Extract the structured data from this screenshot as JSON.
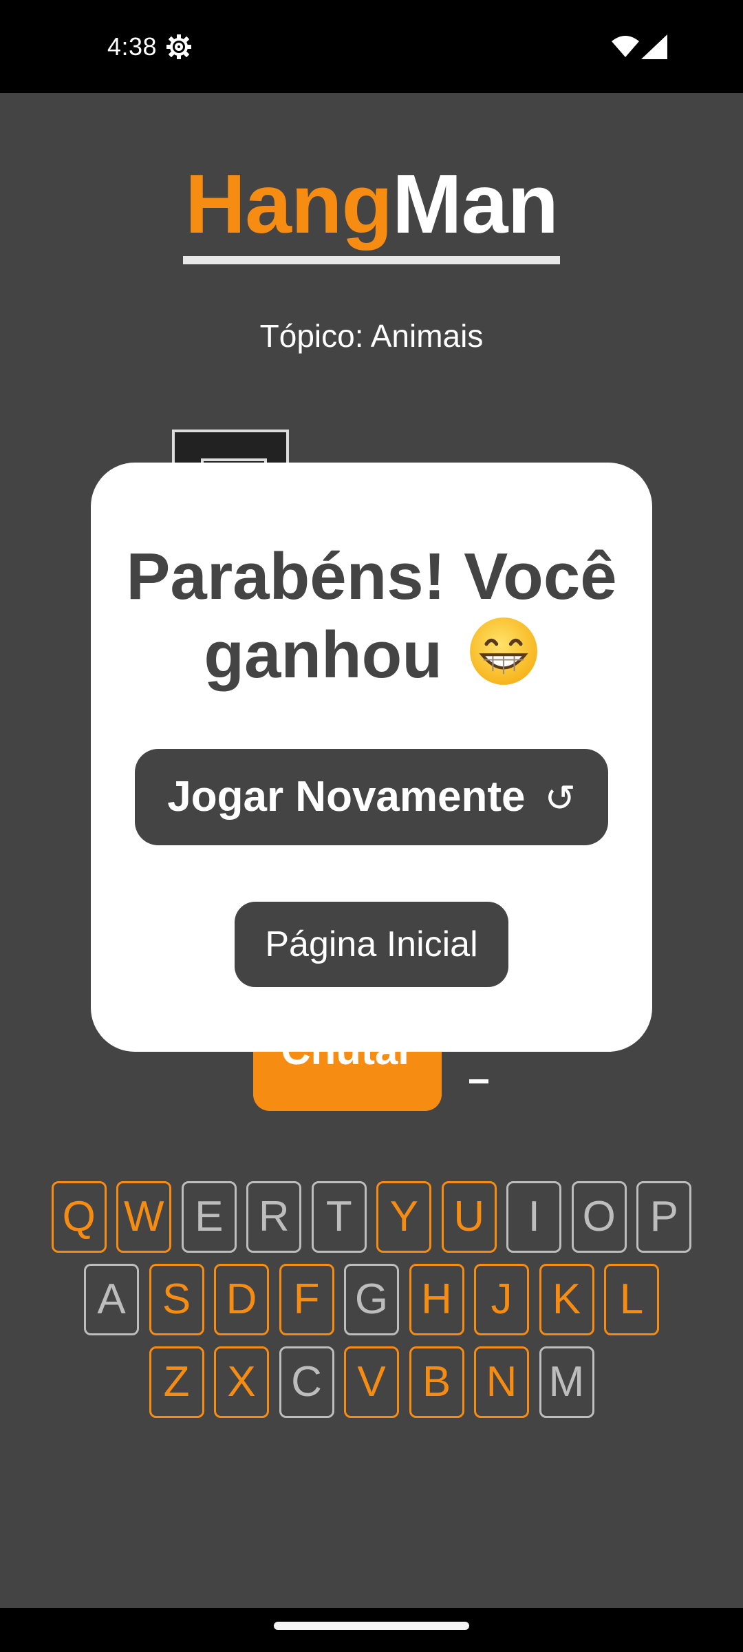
{
  "status_bar": {
    "time": "4:38",
    "icons": [
      "settings-gear-icon",
      "wifi-icon",
      "cellular-signal-icon"
    ]
  },
  "app": {
    "title_part1": "Hang",
    "title_part2": "Man",
    "topic": "Tópico: Animais",
    "guess_button_label": "Chutar",
    "accent_color": "#f78c12",
    "background_color": "#444444"
  },
  "keyboard": {
    "rows": [
      [
        {
          "letter": "Q",
          "used": true
        },
        {
          "letter": "W",
          "used": true
        },
        {
          "letter": "E",
          "used": false
        },
        {
          "letter": "R",
          "used": false
        },
        {
          "letter": "T",
          "used": false
        },
        {
          "letter": "Y",
          "used": true
        },
        {
          "letter": "U",
          "used": true
        },
        {
          "letter": "I",
          "used": false
        },
        {
          "letter": "O",
          "used": false
        },
        {
          "letter": "P",
          "used": false
        }
      ],
      [
        {
          "letter": "A",
          "used": false
        },
        {
          "letter": "S",
          "used": true
        },
        {
          "letter": "D",
          "used": true
        },
        {
          "letter": "F",
          "used": true
        },
        {
          "letter": "G",
          "used": false
        },
        {
          "letter": "H",
          "used": true
        },
        {
          "letter": "J",
          "used": true
        },
        {
          "letter": "K",
          "used": true
        },
        {
          "letter": "L",
          "used": true
        }
      ],
      [
        {
          "letter": "Z",
          "used": true
        },
        {
          "letter": "X",
          "used": true
        },
        {
          "letter": "C",
          "used": false
        },
        {
          "letter": "V",
          "used": true
        },
        {
          "letter": "B",
          "used": true
        },
        {
          "letter": "N",
          "used": true
        },
        {
          "letter": "M",
          "used": false
        }
      ]
    ]
  },
  "modal": {
    "message": "Parabéns! Você ganhou",
    "emoji": "grinning-face-icon",
    "play_again_label": "Jogar Novamente",
    "refresh_icon": "↺",
    "home_label": "Página Inicial"
  }
}
